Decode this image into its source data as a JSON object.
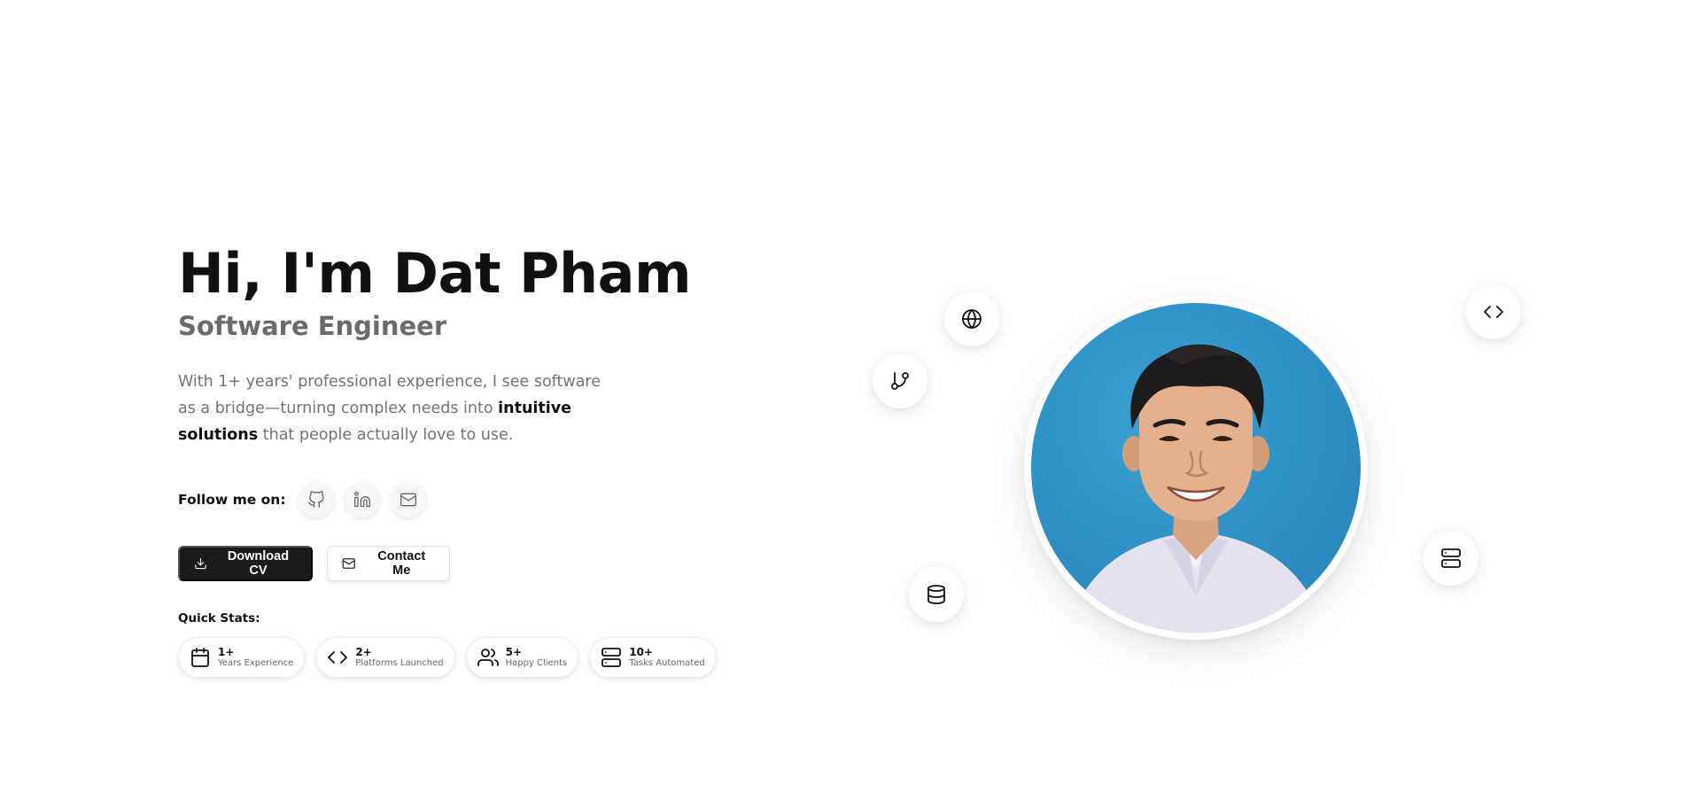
{
  "hero": {
    "title": "Hi, I'm Dat Pham",
    "subtitle": "Software Engineer",
    "bio_part1": "With 1+ years' professional experience, I see software as a bridge—turning complex needs into ",
    "bio_highlight": "intuitive solutions",
    "bio_part2": " that people actually love to use."
  },
  "follow": {
    "label": "Follow me on:",
    "links": [
      {
        "icon": "github-icon"
      },
      {
        "icon": "linkedin-icon"
      },
      {
        "icon": "mail-icon"
      }
    ]
  },
  "buttons": {
    "download_label": "Download CV",
    "download_icon": "download-icon",
    "contact_label": "Contact Me",
    "contact_icon": "mail-icon"
  },
  "stats": {
    "label": "Quick Stats:",
    "items": [
      {
        "value": "1+",
        "label": "Years Experience",
        "icon": "calendar-icon"
      },
      {
        "value": "2+",
        "label": "Platforms Launched",
        "icon": "code-icon"
      },
      {
        "value": "5+",
        "label": "Happy Clients",
        "icon": "users-icon"
      },
      {
        "value": "10+",
        "label": "Tasks Automated",
        "icon": "server-icon"
      }
    ]
  },
  "floating_icons": [
    "globe-icon",
    "git-branch-icon",
    "database-icon",
    "code-icon",
    "server-icon"
  ],
  "colors": {
    "primary_dark": "#1b1b1b",
    "photo_background": "#2d8fc4",
    "muted_text": "#737373"
  }
}
